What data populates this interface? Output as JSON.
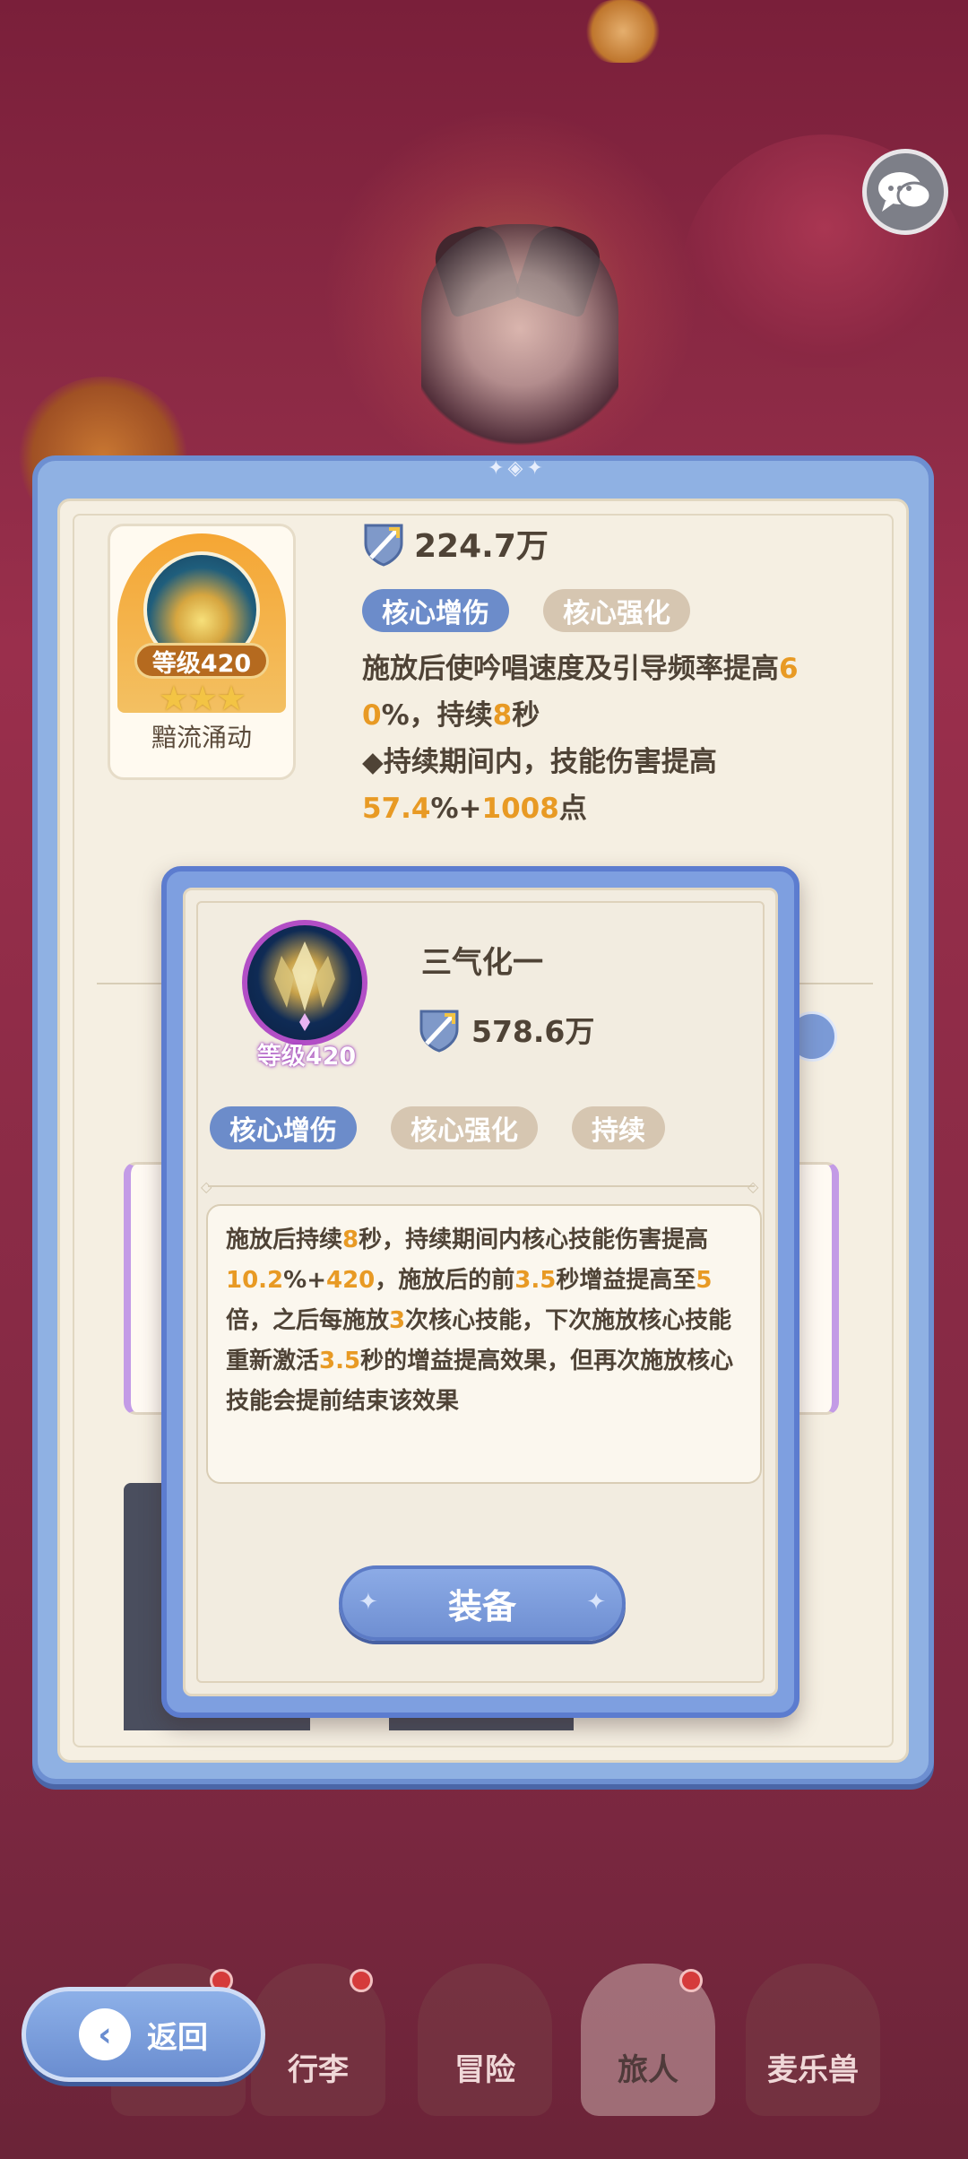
{
  "top_skill": {
    "level": "等级420",
    "stars": "★★★",
    "name": "黯流涌动",
    "power": "224.7万",
    "tags": [
      "核心增伤",
      "核心强化"
    ],
    "desc": {
      "line1_a": "施放后使吟唱速度及引导频率提高",
      "line1_hl": "6",
      "line2_hl": "0",
      "line2_a": "%，持续",
      "line2_hl2": "8",
      "line2_b": "秒",
      "line3": "◆持续期间内，技能伤害提高",
      "line4_hl": "57.4",
      "line4_a": "%+",
      "line4_hl2": "1008",
      "line4_b": "点"
    }
  },
  "popup": {
    "level": "等级420",
    "title": "三气化一",
    "power": "578.6万",
    "tags": [
      "核心增伤",
      "核心强化",
      "持续"
    ],
    "desc": {
      "s1": "施放后持续",
      "h1": "8",
      "s2": "秒，持续期间内核心技能伤害提高",
      "h2": "10.2",
      "s3": "%+",
      "h3": "420",
      "s4": "，施放后的前",
      "h4": "3.5",
      "s5": "秒增益提高至",
      "h5": "5",
      "s6": "倍，之后每施放",
      "h6": "3",
      "s7": "次核心技能，下次施放核心技能重新激活",
      "h7": "3.5",
      "s8": "秒的增益提高效果，但再次施放核心技能会提前结束该效果"
    },
    "equip_label": "装备"
  },
  "nav": {
    "back_label": "返回",
    "items": [
      "行李",
      "冒险",
      "旅人",
      "麦乐兽"
    ]
  },
  "colors": {
    "accent_blue": "#6c8cca",
    "highlight_orange": "#e89a24",
    "panel_cream": "#f5efe2"
  }
}
